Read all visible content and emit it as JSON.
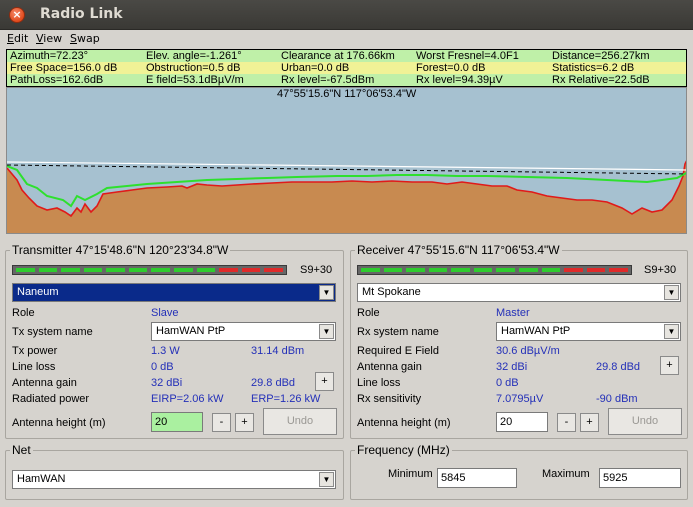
{
  "window": {
    "title": "Radio Link",
    "close_icon": "close-icon"
  },
  "menu": [
    "Edit",
    "View",
    "Swap"
  ],
  "info": {
    "row1": [
      "Azimuth=72.23°",
      "Elev. angle=-1.261°",
      "Clearance at 176.66km",
      "Worst Fresnel=4.0F1",
      "Distance=256.27km"
    ],
    "row2": [
      "Free Space=156.0 dB",
      "Obstruction=0.5 dB",
      "Urban=0.0 dB",
      "Forest=0.0 dB",
      "Statistics=6.2 dB"
    ],
    "row3": [
      "PathLoss=162.6dB",
      "E field=53.1dBµV/m",
      "Rx level=-67.5dBm",
      "Rx level=94.39µV",
      "Rx Relative=22.5dB"
    ]
  },
  "profile": {
    "cursor_coord": "47°55'15.6\"N 117°06'53.4\"W"
  },
  "transmitter": {
    "title": "Transmitter 47°15'48.6\"N 120°23'34.8\"W",
    "signal_label": "S9+30",
    "signal_level": "S9+30",
    "site": "Naneum",
    "role_label": "Role",
    "role_value": "Slave",
    "system_label": "Tx system name",
    "system_value": "HamWAN PtP",
    "power_label": "Tx power",
    "power_w": "1.3 W",
    "power_dbm": "31.14 dBm",
    "loss_label": "Line loss",
    "loss_value": "0 dB",
    "gain_label": "Antenna gain",
    "gain_dbi": "32 dBi",
    "gain_dbd": "29.8 dBd",
    "gain_plus": "+",
    "rad_label": "Radiated power",
    "eirp": "EIRP=2.06 kW",
    "erp": "ERP=1.26 kW",
    "height_label": "Antenna height (m)",
    "height_value": "20",
    "minus": "-",
    "plus": "+",
    "undo": "Undo"
  },
  "receiver": {
    "title": "Receiver 47°55'15.6\"N 117°06'53.4\"W",
    "signal_label": "S9+30",
    "signal_level": "S9+30",
    "site": "Mt Spokane",
    "role_label": "Role",
    "role_value": "Master",
    "system_label": "Rx system name",
    "system_value": "HamWAN PtP",
    "field_label": "Required E Field",
    "field_value": "30.6 dBµV/m",
    "gain_label": "Antenna gain",
    "gain_dbi": "32 dBi",
    "gain_dbd": "29.8 dBd",
    "gain_plus": "+",
    "loss_label": "Line loss",
    "loss_value": "0 dB",
    "sens_label": "Rx sensitivity",
    "sens_uv": "7.0795µV",
    "sens_dbm": "-90 dBm",
    "height_label": "Antenna height (m)",
    "height_value": "20",
    "minus": "-",
    "plus": "+",
    "undo": "Undo"
  },
  "net": {
    "title": "Net",
    "value": "HamWAN"
  },
  "frequency": {
    "title": "Frequency (MHz)",
    "min_label": "Minimum",
    "min_value": "5845",
    "max_label": "Maximum",
    "max_value": "5925"
  },
  "colors": {
    "info_bg": "#bff0a8",
    "terrain": "#c88a50",
    "earth": "#7a4a34",
    "sky": "#a6c1d0",
    "blue_text": "#2430b8"
  }
}
